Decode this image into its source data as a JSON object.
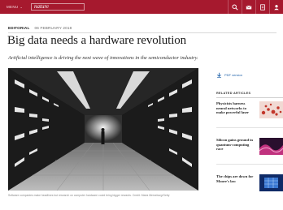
{
  "nav": {
    "menu_label": "MENU",
    "menu_chevron": "⌄",
    "brand": "nature",
    "icons": [
      "search-icon",
      "email-icon",
      "download-icon",
      "account-icon"
    ],
    "bar_color": "#a6192e"
  },
  "article": {
    "type": "EDITORIAL",
    "date": "06 FEBRUARY 2018",
    "title": "Big data needs a hardware revolution",
    "standfirst": "Artificial intelligence is driving the next wave of innovations in the semiconductor industry.",
    "caption": "Software companies make headlines but research on computer hardware could bring bigger rewards.   Credit: Maria Merseburg/Getty"
  },
  "sidebar": {
    "pdf_label": "PDF version",
    "related_heading": "RELATED ARTICLES",
    "related": [
      {
        "title": "Physicists harness neural networks to make powerful laser",
        "thumb": "red-dots-thumbnail"
      },
      {
        "title": "Silicon gains ground in quantum-computing race",
        "thumb": "magenta-wave-thumbnail"
      },
      {
        "title": "The chips are down for Moore's law",
        "thumb": "blue-chip-thumbnail"
      }
    ],
    "link_color": "#1c5fa8"
  }
}
